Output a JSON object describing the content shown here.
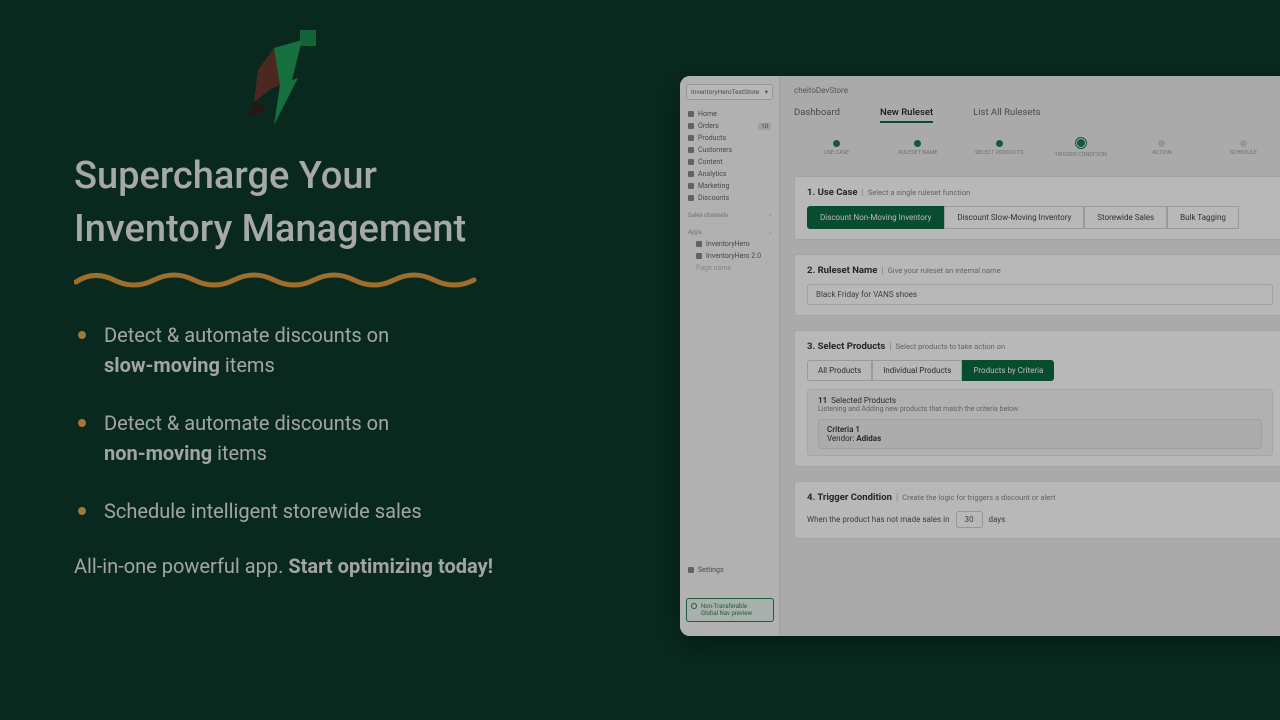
{
  "marketing": {
    "headline_line1": "Supercharge Your",
    "headline_line2": "Inventory Management",
    "bullets": [
      {
        "pre": "Detect & automate discounts on ",
        "strong": "slow-moving",
        "post": " items"
      },
      {
        "pre": "Detect & automate discounts on ",
        "strong": "non-moving",
        "post": " items"
      },
      {
        "pre": "Schedule intelligent storewide sales",
        "strong": "",
        "post": ""
      }
    ],
    "tagline_pre": "All-in-one powerful app. ",
    "tagline_strong": "Start optimizing today!"
  },
  "app": {
    "sidebar": {
      "store_selector": "InventoryHeroTestStore",
      "nav": [
        "Home",
        "Orders",
        "Products",
        "Customers",
        "Content",
        "Analytics",
        "Marketing",
        "Discounts"
      ],
      "orders_badge": "10",
      "section_sales": "Sales channels",
      "section_apps": "Apps",
      "apps": [
        "InventoryHero",
        "InventoryHero 2.0",
        "Page name"
      ],
      "settings": "Settings",
      "notice_line1": "Non-Transferable",
      "notice_line2": "Global Nav preview"
    },
    "breadcrumb": "cheitoDevStore",
    "tabs": {
      "dashboard": "Dashboard",
      "new_ruleset": "New Ruleset",
      "list_all": "List All Rulesets"
    },
    "steps": [
      "USE CASE",
      "RULESET NAME",
      "SELECT PRODUCTS",
      "TRIGGER CONDITION",
      "ACTION",
      "SCHEDULE"
    ],
    "panel1": {
      "title_num": "1. Use Case",
      "title_sub": "Select a single ruleset function",
      "choices": [
        "Discount Non-Moving Inventory",
        "Discount Slow-Moving Inventory",
        "Storewide Sales",
        "Bulk Tagging"
      ]
    },
    "panel2": {
      "title_num": "2. Ruleset Name",
      "title_sub": "Give your ruleset an internal name",
      "value": "Black Friday for VANS shoes"
    },
    "panel3": {
      "title_num": "3. Select Products",
      "title_sub": "Select products to take action on",
      "tabs": [
        "All Products",
        "Individual Products",
        "Products by Criteria"
      ],
      "selected_count": "11",
      "selected_label": "Selected Products",
      "listening": "Listening and Adding new products that match the criteria below",
      "criteria_title": "Criteria 1",
      "criteria_vendor_label": "Vendor:",
      "criteria_vendor": "Adidas"
    },
    "panel4": {
      "title_num": "4. Trigger Condition",
      "title_sub": "Create the logic for triggers a discount or alert",
      "sentence_pre": "When the product has not made sales in",
      "days_value": "30",
      "sentence_post": "days"
    }
  }
}
